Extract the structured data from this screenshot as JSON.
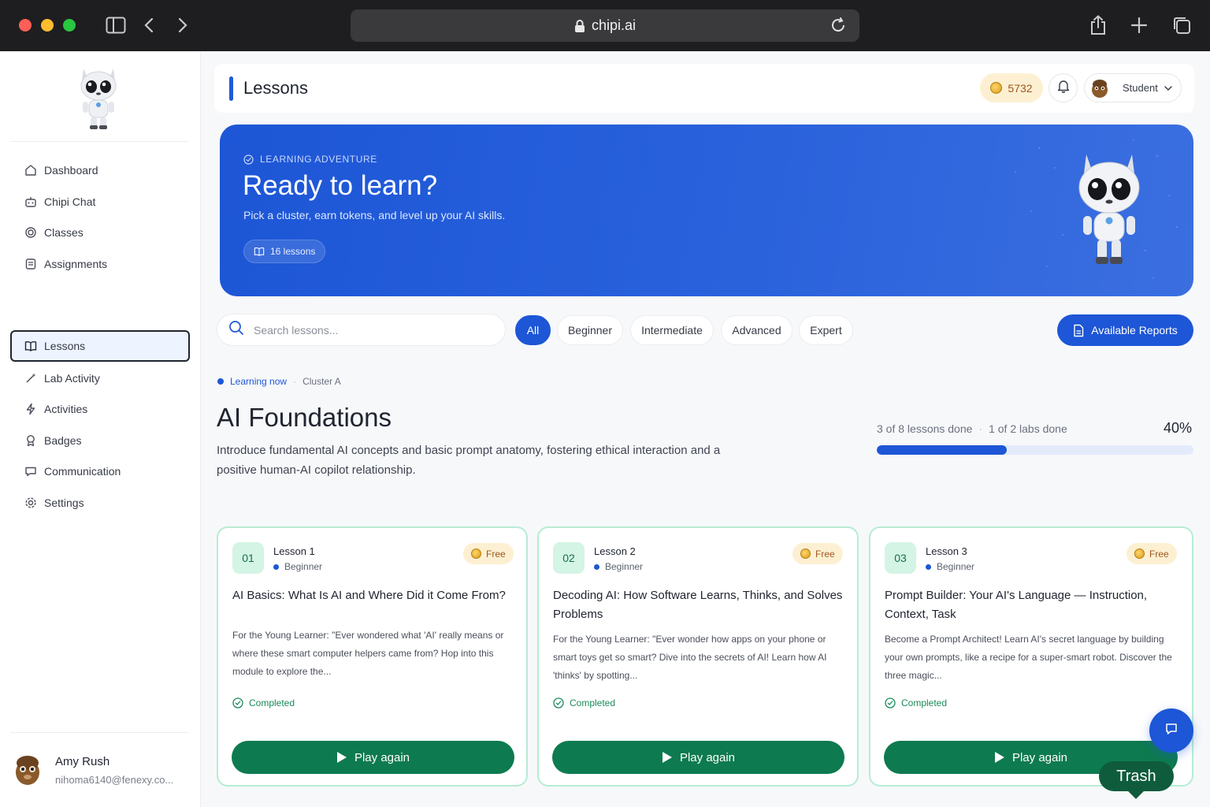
{
  "browser": {
    "url": "chipi.ai"
  },
  "sidebar": {
    "items": [
      {
        "label": "Dashboard",
        "icon": "home-icon"
      },
      {
        "label": "Chipi Chat",
        "icon": "robot-icon"
      },
      {
        "label": "Classes",
        "icon": "classes-icon"
      },
      {
        "label": "Assignments",
        "icon": "assignment-icon"
      },
      {
        "label": "Lessons",
        "icon": "book-icon",
        "active": true
      },
      {
        "label": "Lab Activity",
        "icon": "wand-icon"
      },
      {
        "label": "Activities",
        "icon": "bolt-icon"
      },
      {
        "label": "Badges",
        "icon": "badge-icon"
      },
      {
        "label": "Communication",
        "icon": "chat-icon"
      },
      {
        "label": "Settings",
        "icon": "gear-icon"
      }
    ],
    "user": {
      "name": "Amy Rush",
      "email": "nihoma6140@fenexy.co..."
    }
  },
  "header": {
    "title": "Lessons",
    "tokens": "5732",
    "role": "Student"
  },
  "hero": {
    "eyebrow": "LEARNING ADVENTURE",
    "title": "Ready to learn?",
    "subtitle": "Pick a cluster, earn tokens, and level up your AI skills.",
    "pill": "16 lessons"
  },
  "filters": {
    "search_placeholder": "Search lessons...",
    "chips": [
      "All",
      "Beginner",
      "Intermediate",
      "Advanced",
      "Expert"
    ],
    "active_chip": "All",
    "reports_label": "Available Reports"
  },
  "cluster": {
    "status": "Learning now",
    "name": "Cluster A",
    "title": "AI Foundations",
    "description": "Introduce fundamental AI concepts and basic prompt anatomy, fostering ethical interaction and a positive human-AI copilot relationship.",
    "lessons_done": "3 of 8 lessons done",
    "labs_done": "1 of 2 labs done",
    "percent_label": "40%",
    "progress": 0.41
  },
  "lessons": [
    {
      "number": "01",
      "name": "Lesson 1",
      "level": "Beginner",
      "price": "Free",
      "title": "AI Basics: What Is AI and Where Did it Come From?",
      "description": "For the Young Learner: \"Ever wondered what 'AI' really means or where these smart computer helpers came from? Hop into this module to explore the...",
      "status": "Completed",
      "action": "Play again"
    },
    {
      "number": "02",
      "name": "Lesson 2",
      "level": "Beginner",
      "price": "Free",
      "title": "Decoding AI: How Software Learns, Thinks, and Solves Problems",
      "description": "For the Young Learner: \"Ever wonder how apps on your phone or smart toys get so smart? Dive into the secrets of AI! Learn how AI 'thinks' by spotting...",
      "status": "Completed",
      "action": "Play again"
    },
    {
      "number": "03",
      "name": "Lesson 3",
      "level": "Beginner",
      "price": "Free",
      "title": "Prompt Builder: Your AI's Language — Instruction, Context, Task",
      "description": "Become a Prompt Architect! Learn AI's secret language by building your own prompts, like a recipe for a super-smart robot. Discover the three magic...",
      "status": "Completed",
      "action": "Play again"
    }
  ],
  "tooltip": {
    "label": "Trash"
  },
  "colors": {
    "accent": "#1d56d6",
    "success": "#0e7a4f",
    "token": "#fdf0d2"
  }
}
